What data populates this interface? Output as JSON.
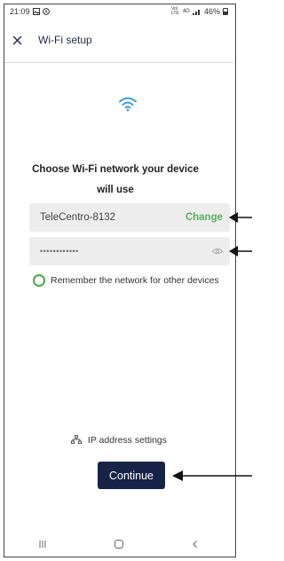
{
  "status_bar": {
    "time": "21:09",
    "signal_text": "Vol LTE",
    "network_type": "4G",
    "battery": "46%"
  },
  "app_bar": {
    "title": "Wi-Fi setup",
    "close_icon": "close-icon"
  },
  "main": {
    "wifi_icon": "wifi-icon",
    "heading_line1": "Choose Wi-Fi network your device",
    "heading_line2": "will use",
    "network_name": "TeleCentro-8132",
    "change_label": "Change",
    "password_mask": "••••••••••••",
    "remember_label": "Remember the network for other devices",
    "ip_settings_label": "IP address settings",
    "continue_label": "Continue"
  },
  "nav_bar": {
    "recent_icon": "recent-apps-icon",
    "home_icon": "home-icon",
    "back_icon": "back-icon"
  },
  "colors": {
    "accent_green": "#55b25d",
    "button_navy": "#172448",
    "field_bg": "#ecedec"
  }
}
